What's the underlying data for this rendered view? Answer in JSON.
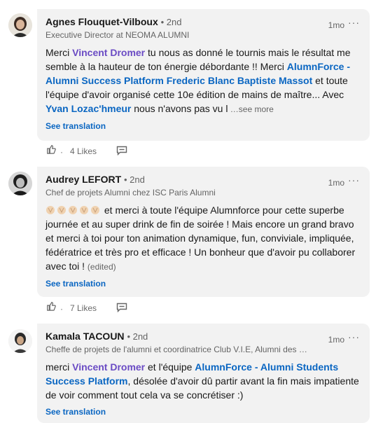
{
  "comments": [
    {
      "name": "Agnes Flouquet-Vilboux",
      "degree": "• 2nd",
      "headline": "Executive Director at NEOMA ALUMNI",
      "time": "1mo",
      "more": "···",
      "text": {
        "p1": "Merci ",
        "m1": "Vincent Dromer",
        "p2": " tu nous as donné le tournis mais le résultat me semble à la hauteur de ton énergie débordante !! Merci ",
        "m2": "AlumnForce - Alumni Success Platform",
        "p3": " ",
        "m3": "Frederic Blanc",
        "p4": " ",
        "m4": "Baptiste Massot",
        "p5": " et toute l'équipe d'avoir organisé cette 10e édition de mains de maître... Avec ",
        "m5": "Yvan Lozac'hmeur",
        "p6": " nous n'avons pas vu l",
        "see_more": " …see more"
      },
      "see_translation": "See translation",
      "likes": "4 Likes",
      "dot": "·"
    },
    {
      "name": "Audrey LEFORT",
      "degree": "• 2nd",
      "headline": "Chef de projets Alumni chez ISC Paris Alumni",
      "time": "1mo",
      "more": "···",
      "text": {
        "p1": " et merci à toute l'équipe Alumnforce pour cette superbe journée et au super drink de fin de soirée ! Mais encore un grand bravo et merci à toi pour ton animation dynamique, fun, conviviale, impliquée, fédératrice et  très pro et efficace ! Un bonheur que d'avoir pu collaborer avec toi ! ",
        "edited": "(edited)"
      },
      "see_translation": "See translation",
      "likes": "7 Likes",
      "dot": "·"
    },
    {
      "name": "Kamala TACOUN",
      "degree": "• 2nd",
      "headline": "Cheffe de projets de l'alumni et coordinatrice Club V.I.E, Alumni des …",
      "time": "1mo",
      "more": "···",
      "text": {
        "p1": "merci ",
        "m1": "Vincent Dromer",
        "p2": " et l'équipe ",
        "m2": "AlumnForce - Alumni Students Success Platform",
        "p3": ", désolée d'avoir dû partir avant la fin mais impatiente de voir comment tout cela va se concrétiser :)"
      },
      "see_translation": "See translation"
    }
  ]
}
